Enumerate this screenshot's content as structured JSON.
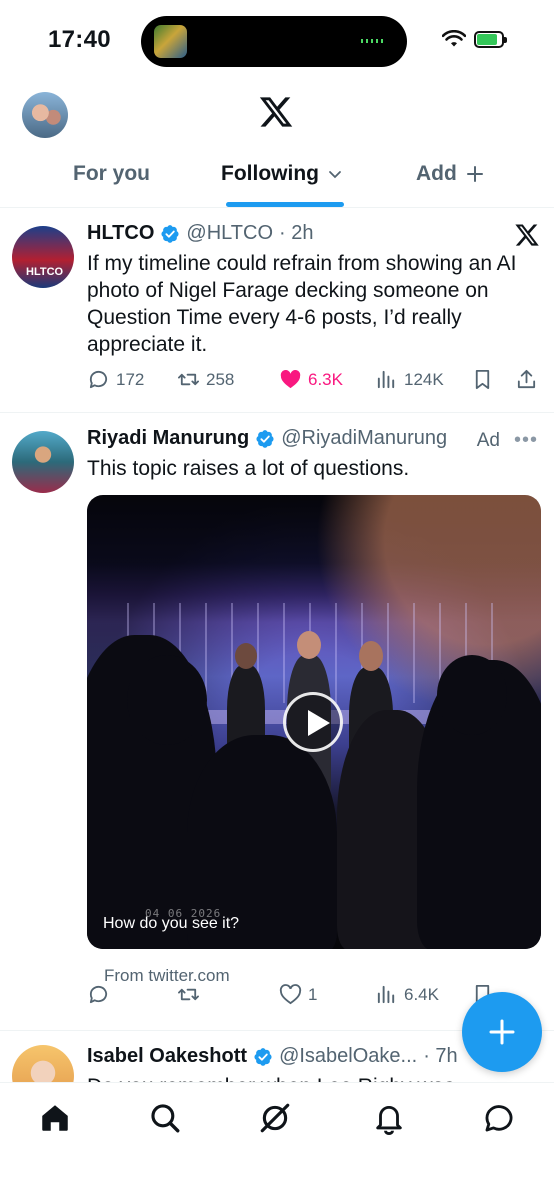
{
  "status_bar": {
    "time": "17:40",
    "battery_level": 0.85,
    "icons": [
      "wifi-icon",
      "battery-charging-icon"
    ]
  },
  "header": {
    "logo": "x-logo-icon"
  },
  "tabs": [
    {
      "label": "For you",
      "active": false
    },
    {
      "label": "Following",
      "active": true
    },
    {
      "label": "Add",
      "active": false
    }
  ],
  "tweets": [
    {
      "name": "HLTCO",
      "handle": "@HLTCO",
      "time": "· 2h",
      "avatar_text": "HLTCO",
      "text": "If my timeline could refrain from showing an AI photo of Nigel Farage decking someone on Question Time every 4-6 posts, I’d really appreciate it.",
      "replies": "172",
      "reposts": "258",
      "likes": "6.3K",
      "views": "124K",
      "liked": true
    },
    {
      "name": "Riyadi Manurung",
      "handle": "@RiyadiManurung",
      "ad_label": "Ad",
      "text": "This topic raises a lot of questions.",
      "media_date": "04 06 2026",
      "media_caption": "How do you see it?",
      "from": "From twitter.com",
      "replies": "",
      "reposts": "",
      "likes": "1",
      "views": "6.4K"
    },
    {
      "name": "Isabel Oakeshott",
      "handle": "@IsabelOake...",
      "time": "· 7h",
      "text": "Do you remember when Lee Rigby was"
    }
  ],
  "colors": {
    "accent": "#1d9bf0",
    "like": "#f91880",
    "secondary_text": "#536471"
  },
  "bottom_nav": [
    "home-icon",
    "search-icon",
    "grok-icon",
    "notifications-icon",
    "messages-icon"
  ]
}
